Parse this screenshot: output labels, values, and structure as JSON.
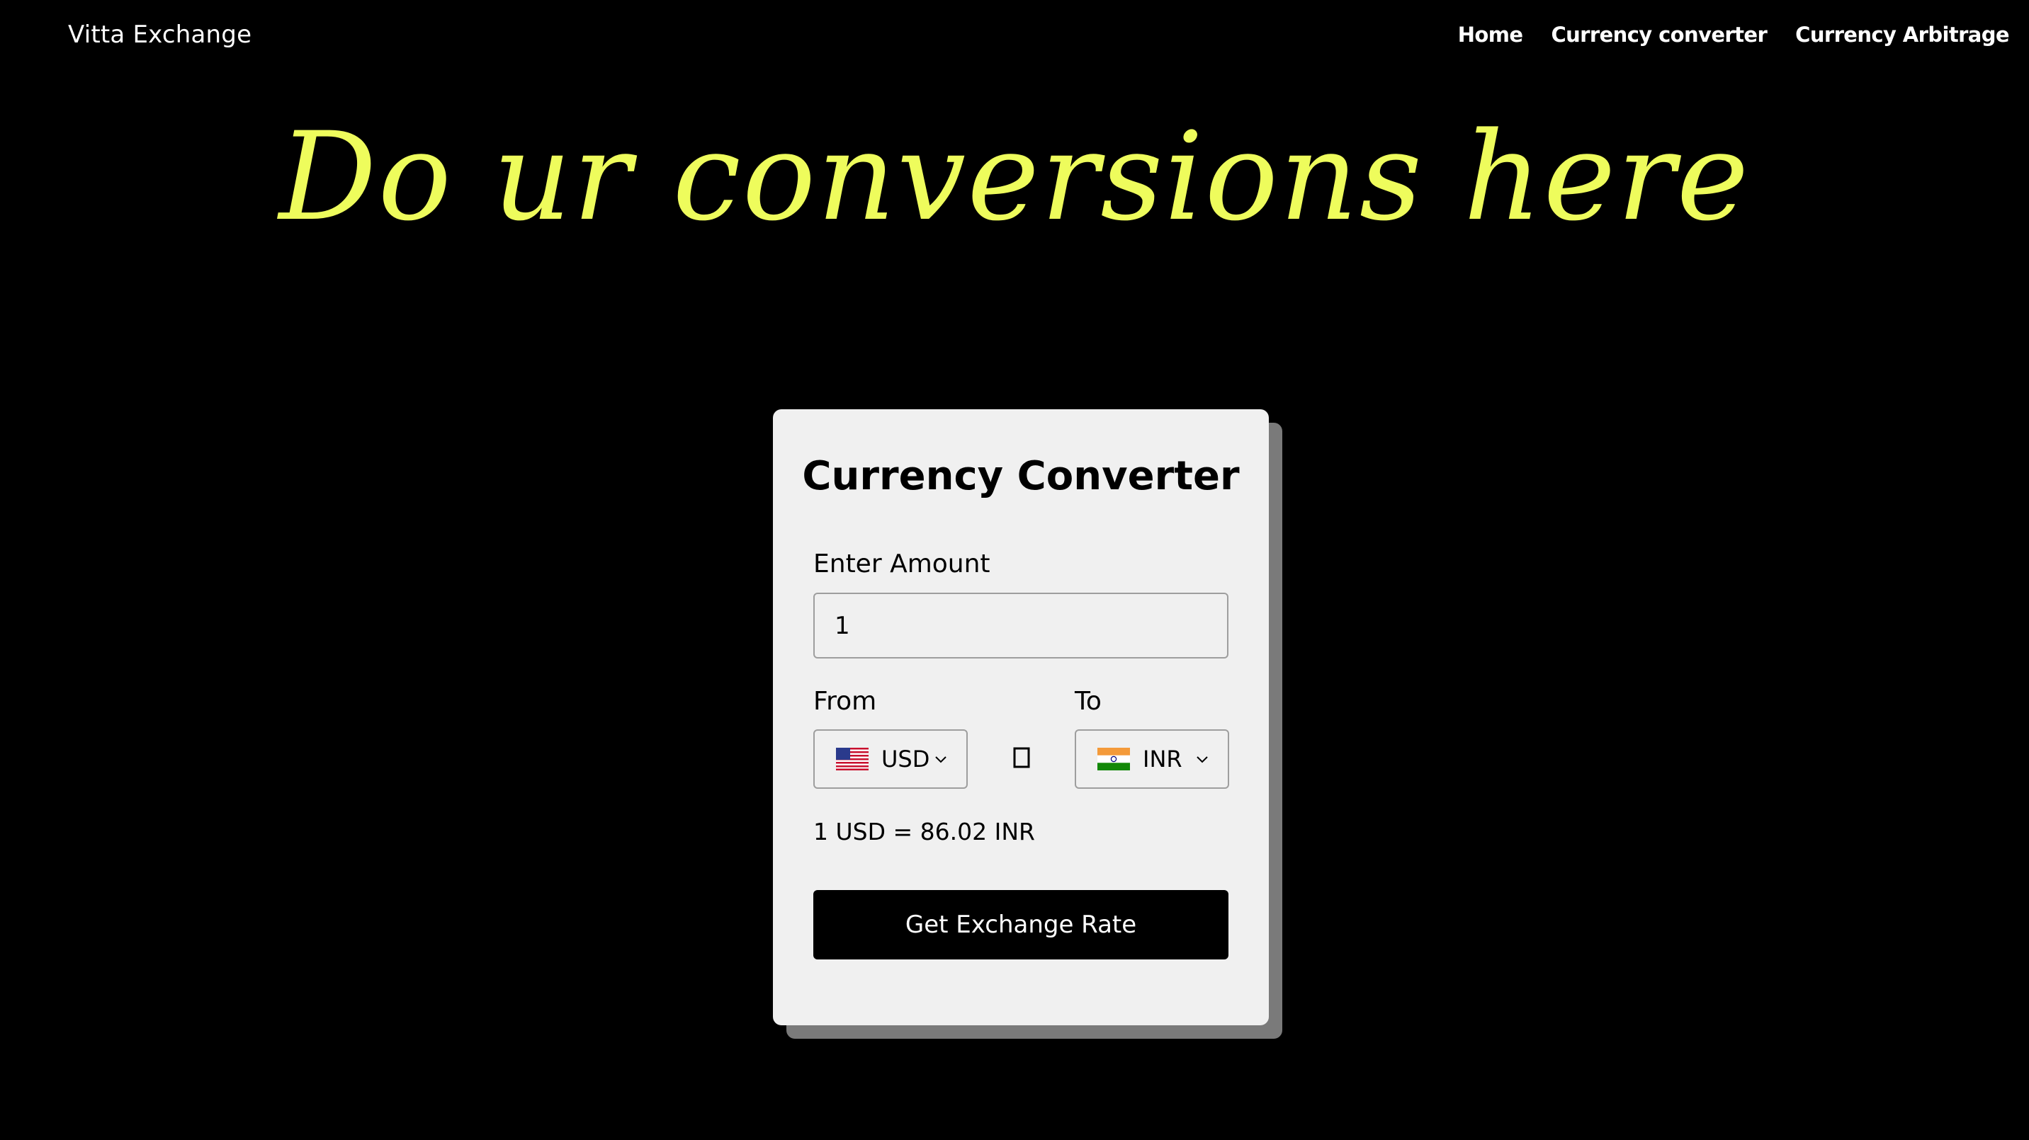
{
  "navbar": {
    "brand": "Vitta Exchange",
    "links": [
      "Home",
      "Currency converter",
      "Currency Arbitrage"
    ]
  },
  "hero": {
    "heading": "Do ur conversions here",
    "color": "#eefc5c"
  },
  "converter": {
    "title": "Currency Converter",
    "amount_label": "Enter Amount",
    "amount_value": "1",
    "from_label": "From",
    "to_label": "To",
    "from_currency": "USD",
    "to_currency": "INR",
    "from_flag_icon": "us-flag-icon",
    "to_flag_icon": "india-flag-icon",
    "rate_text": "1 USD = 86.02 INR",
    "button_label": "Get Exchange Rate"
  }
}
